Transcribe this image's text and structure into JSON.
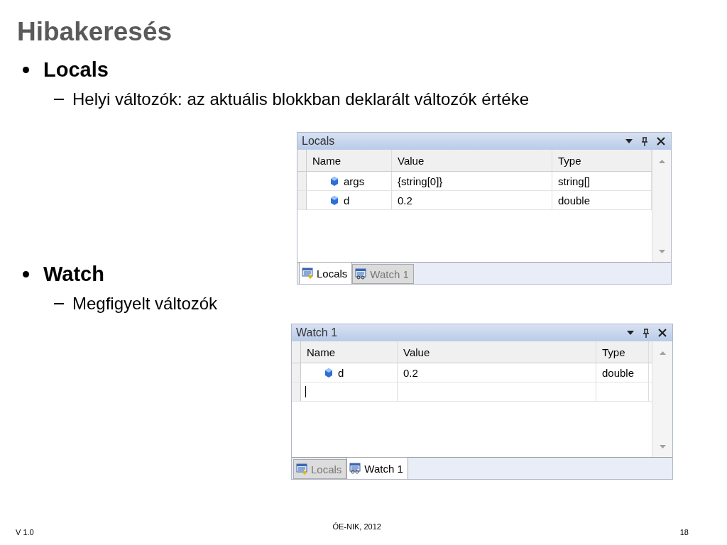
{
  "title": "Hibakeresés",
  "sections": [
    {
      "bullet": "Locals",
      "sub": "Helyi változók: az aktuális blokkban deklarált változók értéke",
      "panel": {
        "title": "Locals",
        "columns": [
          "Name",
          "Value",
          "Type"
        ],
        "rows": [
          {
            "kind": "variable",
            "name": "args",
            "value": "{string[0]}",
            "type": "string[]"
          },
          {
            "kind": "variable",
            "name": "d",
            "value": "0.2",
            "type": "double"
          }
        ],
        "tabs": [
          {
            "label": "Locals",
            "selected": true
          },
          {
            "label": "Watch 1",
            "selected": false
          }
        ]
      }
    },
    {
      "bullet": "Watch",
      "sub": "Megfigyelt változók",
      "panel": {
        "title": "Watch 1",
        "columns": [
          "Name",
          "Value",
          "Type"
        ],
        "rows": [
          {
            "kind": "variable",
            "name": "d",
            "value": "0.2",
            "type": "double"
          },
          {
            "kind": "new"
          }
        ],
        "tabs": [
          {
            "label": "Locals",
            "selected": false
          },
          {
            "label": "Watch 1",
            "selected": true
          }
        ]
      }
    }
  ],
  "footer": {
    "version": "V 1.0",
    "center": "ÓE-NIK, 2012",
    "page": "18"
  }
}
